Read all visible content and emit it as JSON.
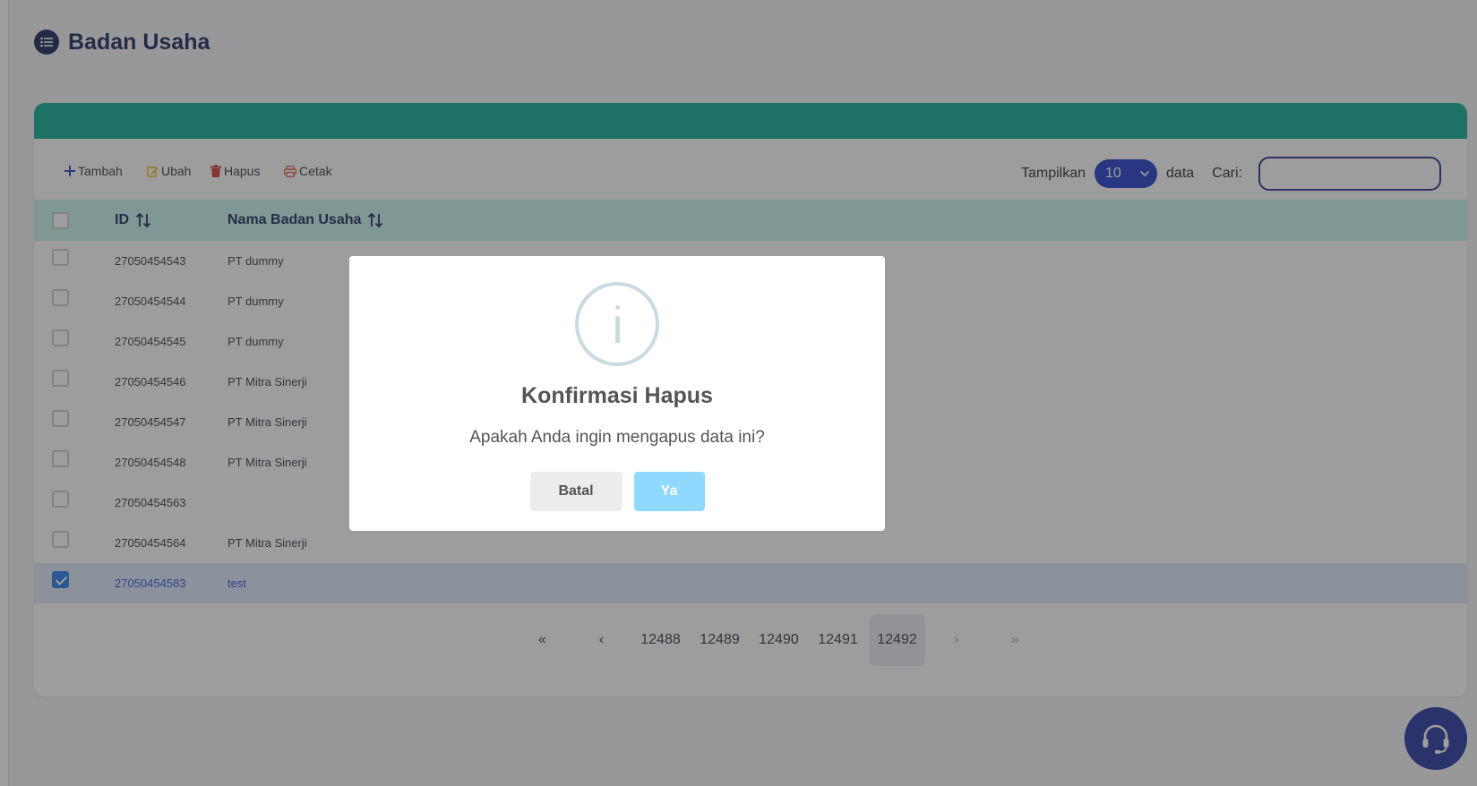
{
  "page": {
    "title": "Badan Usaha"
  },
  "toolbar": {
    "add_label": "Tambah",
    "edit_label": "Ubah",
    "delete_label": "Hapus",
    "print_label": "Cetak",
    "show_label": "Tampilkan",
    "page_size": "10",
    "data_label": "data",
    "search_label": "Cari:",
    "search_value": ""
  },
  "table": {
    "headers": {
      "id": "ID",
      "name": "Nama Badan Usaha"
    },
    "rows": [
      {
        "id": "27050454543",
        "name": "PT dummy",
        "checked": false
      },
      {
        "id": "27050454544",
        "name": "PT dummy",
        "checked": false
      },
      {
        "id": "27050454545",
        "name": "PT dummy",
        "checked": false
      },
      {
        "id": "27050454546",
        "name": "PT Mitra Sinerji",
        "checked": false
      },
      {
        "id": "27050454547",
        "name": "PT Mitra Sinerji",
        "checked": false
      },
      {
        "id": "27050454548",
        "name": "PT Mitra Sinerji",
        "checked": false
      },
      {
        "id": "27050454563",
        "name": "",
        "checked": false
      },
      {
        "id": "27050454564",
        "name": "PT Mitra Sinerji",
        "checked": false
      },
      {
        "id": "27050454583",
        "name": "test",
        "checked": true
      }
    ]
  },
  "pagination": {
    "first": "«",
    "prev": "‹",
    "pages": [
      "12488",
      "12489",
      "12490",
      "12491",
      "12492"
    ],
    "current": "12492",
    "next": "›",
    "last": "»"
  },
  "modal": {
    "title": "Konfirmasi Hapus",
    "message": "Apakah Anda ingin mengapus data ini?",
    "cancel_label": "Batal",
    "confirm_label": "Ya"
  },
  "colors": {
    "brand_teal": "#00a88f",
    "header_row": "#c4f4ec",
    "navy": "#0d1b52",
    "select_blue": "#1730c8",
    "confirm_button": "#8fd8ff"
  },
  "icons": {
    "title": "list-icon",
    "add": "plus-icon",
    "edit": "pencil-icon",
    "delete": "trash-icon",
    "print": "printer-icon",
    "support": "headset-icon",
    "modal": "info-icon"
  }
}
